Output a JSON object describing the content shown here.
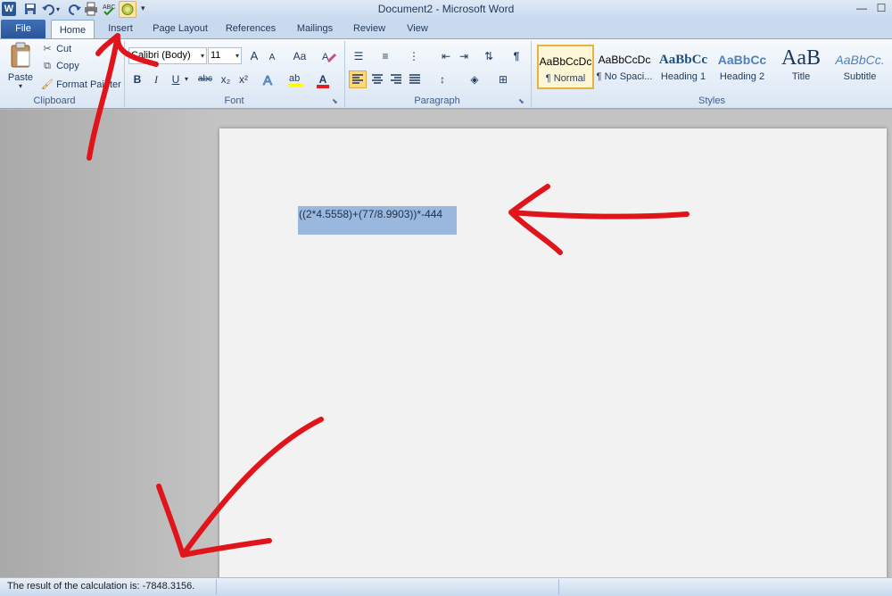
{
  "window": {
    "title": "Document2  -  Microsoft Word",
    "controls": {
      "minimize": "—",
      "maximize": "☐"
    }
  },
  "quick_access": {
    "word_icon": "W",
    "items": [
      "save-icon",
      "undo-icon",
      "redo-icon",
      "print-icon",
      "spelling-icon",
      "calculate-icon",
      "customize-qat-icon"
    ]
  },
  "tabs": [
    "File",
    "Home",
    "Insert",
    "Page Layout",
    "References",
    "Mailings",
    "Review",
    "View"
  ],
  "ribbon": {
    "clipboard": {
      "label": "Clipboard",
      "paste": "Paste",
      "cut": "Cut",
      "copy": "Copy",
      "format_painter": "Format Painter"
    },
    "font": {
      "label": "Font",
      "font_name": "Calibri (Body)",
      "font_size": "11",
      "grow": "A",
      "shrink": "A",
      "change_case": "Aa",
      "bold": "B",
      "italic": "I",
      "underline": "U",
      "strikethrough": "abc",
      "subscript": "x₂",
      "superscript": "x²",
      "font_color": "A"
    },
    "paragraph": {
      "label": "Paragraph",
      "pilcrow": "¶"
    },
    "styles": {
      "label": "Styles",
      "items": [
        {
          "preview": "AaBbCcDc",
          "name": "¶ Normal"
        },
        {
          "preview": "AaBbCcDc",
          "name": "¶ No Spaci..."
        },
        {
          "preview": "AaBbCc",
          "name": "Heading 1"
        },
        {
          "preview": "AaBbCc",
          "name": "Heading 2"
        },
        {
          "preview": "AaB",
          "name": "Title"
        },
        {
          "preview": "AaBbCc.",
          "name": "Subtitle"
        }
      ]
    }
  },
  "document": {
    "text": "((2*4.5558)+(77/8.9903))*-444"
  },
  "statusbar": {
    "text": "The result of the calculation is: -7848.3156."
  },
  "colors": {
    "file_tab": "#2a5699",
    "selection": "#9ab8dd",
    "annotation_arrows": "#e0141b",
    "font_color_bar": "#e32020",
    "highlight_bar": "#ffff00"
  }
}
